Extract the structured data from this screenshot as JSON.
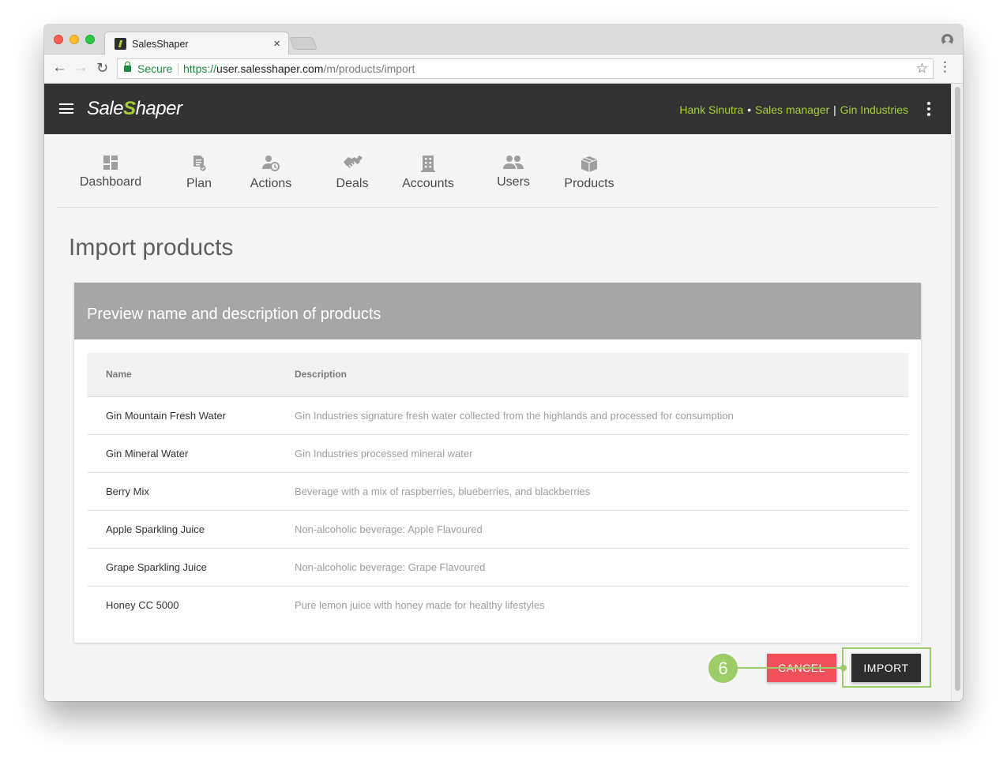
{
  "browser": {
    "tab_title": "SalesShaper",
    "close_glyph": "×",
    "secure_label": "Secure",
    "url_scheme": "https://",
    "url_host": "user.salesshaper.com",
    "url_path": "/m/products/import",
    "back_glyph": "←",
    "forward_glyph": "→",
    "reload_glyph": "↻",
    "star_glyph": "☆",
    "menu_glyph": "⋮"
  },
  "app": {
    "logo_prefix": "Sale",
    "logo_s": "S",
    "logo_suffix": "haper",
    "user": {
      "name": "Hank Sinutra",
      "dot": "•",
      "role": "Sales manager",
      "separator": "|",
      "company": "Gin Industries"
    },
    "accent_color": "#a6d136",
    "header_color": "#333333"
  },
  "nav": {
    "items": [
      {
        "label": "Dashboard",
        "icon": "dashboard-icon"
      },
      {
        "label": "Plan",
        "icon": "plan-icon"
      },
      {
        "label": "Actions",
        "icon": "actions-icon"
      },
      {
        "label": "Deals",
        "icon": "deals-icon"
      },
      {
        "label": "Accounts",
        "icon": "accounts-icon"
      },
      {
        "label": "Users",
        "icon": "users-icon"
      },
      {
        "label": "Products",
        "icon": "products-icon"
      }
    ]
  },
  "page": {
    "title": "Import products",
    "card_title": "Preview name and description of products"
  },
  "table": {
    "headers": {
      "name": "Name",
      "description": "Description"
    },
    "rows": [
      {
        "name": "Gin Mountain Fresh Water",
        "description": "Gin Industries signature fresh water collected from the highlands and processed for consumption"
      },
      {
        "name": "Gin Mineral Water",
        "description": "Gin Industries processed mineral water"
      },
      {
        "name": "Berry Mix",
        "description": "Beverage with a mix of raspberries, blueberries, and blackberries"
      },
      {
        "name": "Apple Sparkling Juice",
        "description": "Non-alcoholic beverage: Apple Flavoured"
      },
      {
        "name": "Grape Sparkling Juice",
        "description": "Non-alcoholic beverage: Grape Flavoured"
      },
      {
        "name": "Honey CC 5000",
        "description": "Pure lemon juice with honey made for healthy lifestyles"
      }
    ]
  },
  "actions": {
    "cancel_label": "CANCEL",
    "import_label": "IMPORT",
    "cancel_color": "#ef5059",
    "import_color": "#2e2e2e"
  },
  "annotation": {
    "step_number": "6",
    "color": "#9ccc65"
  }
}
